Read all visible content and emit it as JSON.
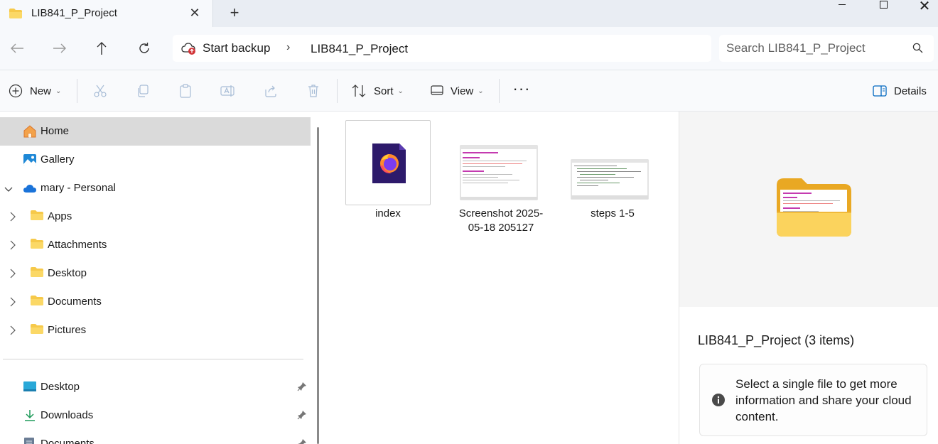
{
  "window": {
    "tab_title": "LIB841_P_Project",
    "close_tab": "✕",
    "new_tab": "+",
    "close": "✕"
  },
  "address": {
    "backup_label": "Start backup",
    "separator": "›",
    "crumb": "LIB841_P_Project"
  },
  "search": {
    "placeholder": "Search LIB841_P_Project"
  },
  "toolbar": {
    "new_label": "New",
    "sort_label": "Sort",
    "view_label": "View",
    "more": "···",
    "details_label": "Details"
  },
  "sidebar": {
    "items": [
      {
        "label": "Home"
      },
      {
        "label": "Gallery"
      },
      {
        "label": "mary - Personal"
      },
      {
        "label": "Apps"
      },
      {
        "label": "Attachments"
      },
      {
        "label": "Desktop"
      },
      {
        "label": "Documents"
      },
      {
        "label": "Pictures"
      }
    ],
    "quick": [
      {
        "label": "Desktop"
      },
      {
        "label": "Downloads"
      },
      {
        "label": "Documents"
      }
    ]
  },
  "files": [
    {
      "name": "index"
    },
    {
      "name": "Screenshot 2025-05-18 205127"
    },
    {
      "name": "steps 1-5"
    }
  ],
  "details": {
    "title": "LIB841_P_Project (3 items)",
    "info": "Select a single file to get more information and share your cloud content."
  },
  "colors": {
    "folder": "#f6c94a",
    "accent": "#0067c0",
    "selected": "#dadada",
    "backup_red": "#d13438"
  }
}
